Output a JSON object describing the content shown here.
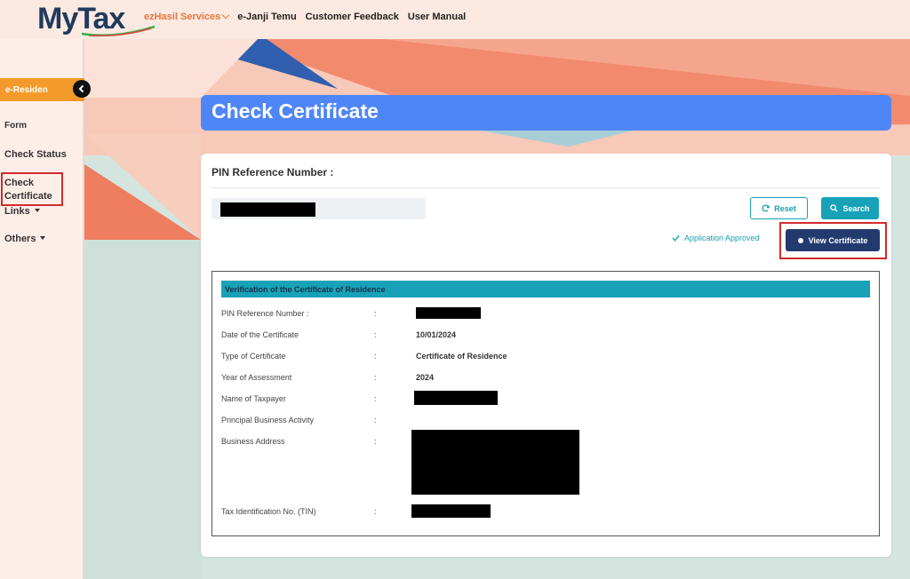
{
  "app": {
    "logo_my": "My",
    "logo_tax": "Tax"
  },
  "topnav": {
    "items": [
      {
        "label": "ezHasil Services",
        "active": true,
        "has_dropdown": true
      },
      {
        "label": "e-Janji Temu",
        "active": false
      },
      {
        "label": "Customer Feedback",
        "active": false
      },
      {
        "label": "User Manual",
        "active": false
      }
    ]
  },
  "sidebar": {
    "header": "e-Residen",
    "items": [
      {
        "label": "Form"
      },
      {
        "label": "Check Status"
      },
      {
        "label": "Check Certificate"
      },
      {
        "label": "Links",
        "has_dropdown": true
      },
      {
        "label": "Others",
        "has_dropdown": true
      }
    ]
  },
  "page": {
    "title": "Check Certificate"
  },
  "search": {
    "pin_label": "PIN Reference Number :",
    "reset_label": "Reset",
    "search_label": "Search",
    "status_text": "Application Approved",
    "view_label": "View Certificate"
  },
  "verification": {
    "heading": "Verification of the Certificate of Residence",
    "rows": [
      {
        "label": "PIN Reference Number :",
        "colon": ":",
        "value": ""
      },
      {
        "label": "Date of the Certificate",
        "colon": ":",
        "value": "10/01/2024"
      },
      {
        "label": "Type of Certificate",
        "colon": ":",
        "value": "Certificate of Residence"
      },
      {
        "label": "Year of Assessment",
        "colon": ":",
        "value": "2024"
      },
      {
        "label": "Name of Taxpayer",
        "colon": ":",
        "value": ""
      },
      {
        "label": "Principal Business Activity",
        "colon": ":",
        "value": ""
      },
      {
        "label": "Business Address",
        "colon": ":",
        "value": ""
      },
      {
        "label": "Tax Identification No. (TIN)",
        "colon": ":",
        "value": ""
      }
    ]
  },
  "colors": {
    "banner": "#4f86f7",
    "accent_teal": "#17a2b8",
    "view_button": "#223a6e",
    "sidebar_header": "#f39a2b",
    "highlight": "#d22b2b"
  }
}
